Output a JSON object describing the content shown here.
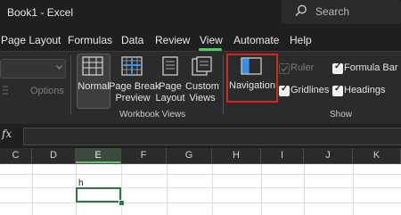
{
  "title": "Book1 - Excel",
  "search": {
    "placeholder": "Search"
  },
  "tabs": [
    "Page Layout",
    "Formulas",
    "Data",
    "Review",
    "View",
    "Automate",
    "Help"
  ],
  "active_tab": "View",
  "ribbon": {
    "options_label": "Options",
    "workbook_views": {
      "normal": "Normal",
      "page_break_preview_1": "Page Break",
      "page_break_preview_2": "Preview",
      "page_layout_1": "Page",
      "page_layout_2": "Layout",
      "custom_views_1": "Custom",
      "custom_views_2": "Views",
      "group_label": "Workbook Views"
    },
    "navigation": "Navigation",
    "show": {
      "ruler": {
        "label": "Ruler",
        "checked": true,
        "enabled": false
      },
      "formula_bar": {
        "label": "Formula Bar",
        "checked": true
      },
      "gridlines": {
        "label": "Gridlines",
        "checked": true
      },
      "headings": {
        "label": "Headings",
        "checked": true
      },
      "group_label": "Show"
    }
  },
  "formula_bar": {
    "fx": "fx",
    "value": ""
  },
  "columns": [
    "C",
    "D",
    "E",
    "F",
    "G",
    "H",
    "I",
    "J",
    "K"
  ],
  "active_column": "E",
  "cells": {
    "E1": "h"
  },
  "colors": {
    "accent": "#61c46b",
    "highlight_border": "#d62424",
    "active_cell": "#2b7a3b"
  }
}
